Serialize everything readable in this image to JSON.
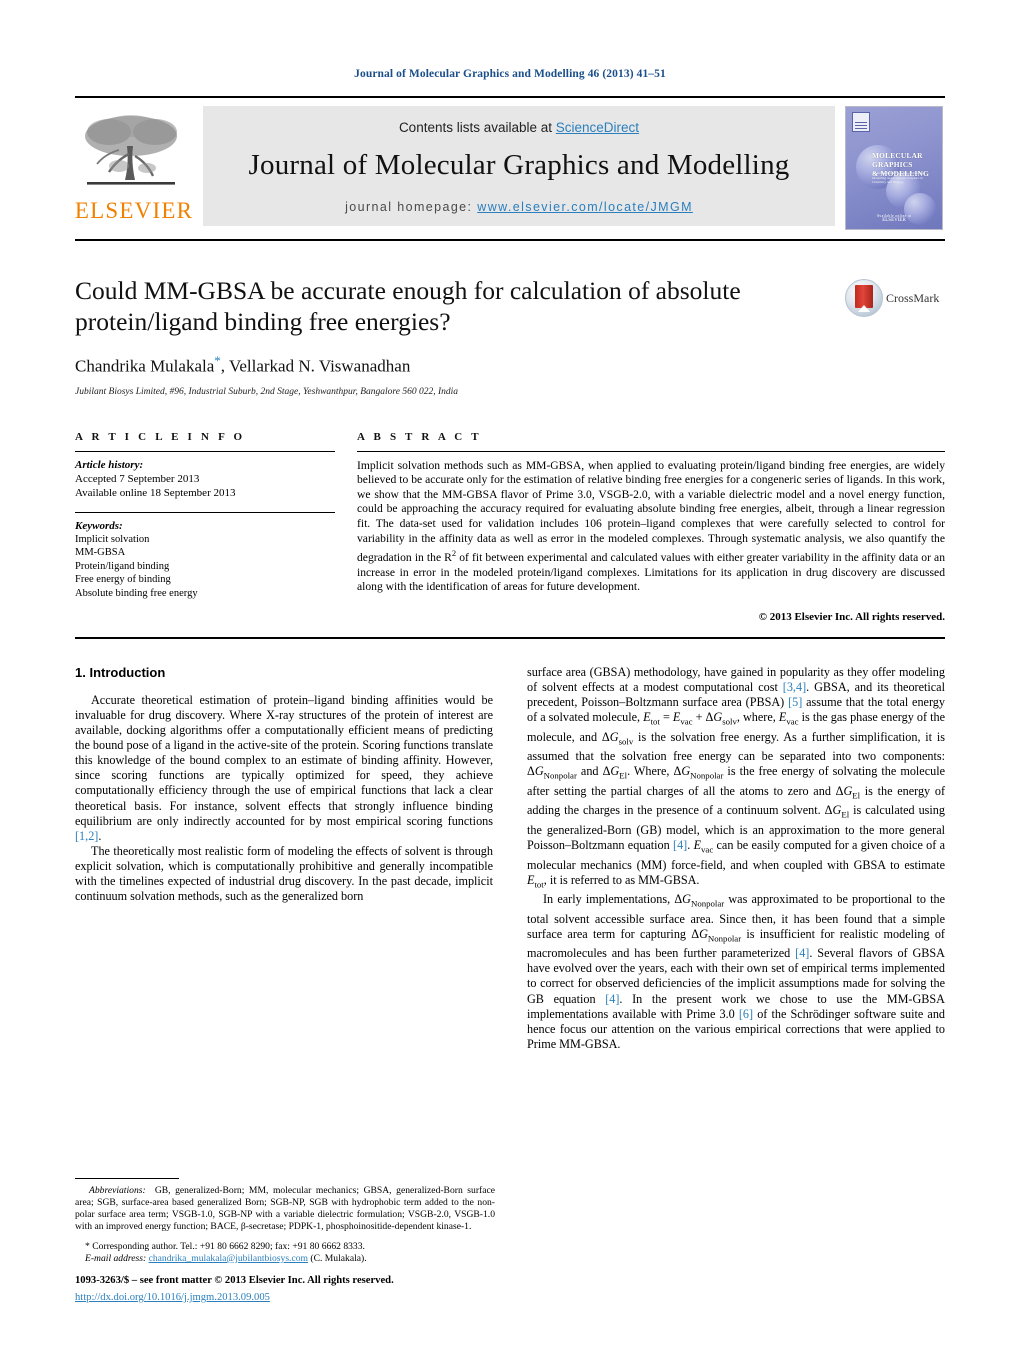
{
  "running_head": "Journal of Molecular Graphics and Modelling 46 (2013) 41–51",
  "masthead": {
    "publisher_name": "ELSEVIER",
    "contents_prefix": "Contents lists available at ",
    "contents_link": "ScienceDirect",
    "journal_title": "Journal of Molecular Graphics and Modelling",
    "homepage_prefix": "journal homepage: ",
    "homepage_url": "www.elsevier.com/locate/JMGM",
    "cover": {
      "title_line1": "MOLECULAR GRAPHICS",
      "title_line2": "& MODELLING",
      "kicker": "Journal of",
      "blurb": "An International Journal for Molecular Modelling and Computer Graphics in Chemistry and Biology",
      "publisher": "ELSEVIER",
      "availability": "Available online at"
    }
  },
  "article": {
    "title": "Could MM-GBSA be accurate enough for calculation of absolute protein/ligand binding free energies?",
    "authors": "Chandrika Mulakala, Vellarkad N. Viswanadhan",
    "author_star": "*",
    "affiliation": "Jubilant Biosys Limited, #96, Industrial Suburb, 2nd Stage, Yeshwanthpur, Bangalore 560 022, India",
    "crossmark_label": "CrossMark"
  },
  "article_info": {
    "heading": "A R T I C L E    I N F O",
    "history_label": "Article history:",
    "history": [
      "Accepted 7 September 2013",
      "Available online 18 September 2013"
    ],
    "keywords_label": "Keywords:",
    "keywords": [
      "Implicit solvation",
      "MM-GBSA",
      "Protein/ligand binding",
      "Free energy of binding",
      "Absolute binding free energy"
    ]
  },
  "abstract": {
    "heading": "A B S T R A C T",
    "text": "Implicit solvation methods such as MM-GBSA, when applied to evaluating protein/ligand binding free energies, are widely believed to be accurate only for the estimation of relative binding free energies for a congeneric series of ligands. In this work, we show that the MM-GBSA flavor of Prime 3.0, VSGB-2.0, with a variable dielectric model and a novel energy function, could be approaching the accuracy required for evaluating absolute binding free energies, albeit, through a linear regression fit. The data-set used for validation includes 106 protein–ligand complexes that were carefully selected to control for variability in the affinity data as well as error in the modeled complexes. Through systematic analysis, we also quantify the degradation in the R",
    "text_sup": "2",
    "text_tail": " of fit between experimental and calculated values with either greater variability in the affinity data or an increase in error in the modeled protein/ligand complexes. Limitations for its application in drug discovery are discussed along with the identification of areas for future development.",
    "copyright": "© 2013 Elsevier Inc. All rights reserved."
  },
  "introduction": {
    "section_number": "1.",
    "section_title": "Introduction",
    "left_paragraphs": [
      "Accurate theoretical estimation of protein–ligand binding affinities would be invaluable for drug discovery. Where X-ray structures of the protein of interest are available, docking algorithms offer a computationally efficient means of predicting the bound pose of a ligand in the active-site of the protein. Scoring functions translate this knowledge of the bound complex to an estimate of binding affinity. However, since scoring functions are typically optimized for speed, they achieve computationally efficiency through the use of empirical functions that lack a clear theoretical basis. For instance, solvent effects that strongly influence binding equilibrium are only indirectly accounted for by most empirical scoring functions [1,2].",
      "The theoretically most realistic form of modeling the effects of solvent is through explicit solvation, which is computationally prohibitive and generally incompatible with the timelines expected of industrial drug discovery. In the past decade, implicit continuum solvation methods, such as the generalized born"
    ],
    "right_paragraph_1": "surface area (GBSA) methodology, have gained in popularity as they offer modeling of solvent effects at a modest computational cost [3,4]. GBSA, and its theoretical precedent, Poisson–Boltzmann surface area (PBSA) [5] assume that the total energy of a solvated molecule, Etot = Evac + ΔGsolv, where, Evac is the gas phase energy of the molecule, and ΔGsolv is the solvation free energy. As a further simplification, it is assumed that the solvation free energy can be separated into two components: ΔGNonpolar and ΔGEl. Where, ΔGNonpolar is the free energy of solvating the molecule after setting the partial charges of all the atoms to zero and ΔGEl is the energy of adding the charges in the presence of a continuum solvent. ΔGEl is calculated using the generalized-Born (GB) model, which is an approximation to the more general Poisson–Boltzmann equation [4]. Evac can be easily computed for a given choice of a molecular mechanics (MM) force-field, and when coupled with GBSA to estimate Etot, it is referred to as MM-GBSA.",
    "right_paragraph_2": "In early implementations, ΔGNonpolar was approximated to be proportional to the total solvent accessible surface area. Since then, it has been found that a simple surface area term for capturing ΔGNonpolar is insufficient for realistic modeling of macromolecules and has been further parameterized [4]. Several flavors of GBSA have evolved over the years, each with their own set of empirical terms implemented to correct for observed deficiencies of the implicit assumptions made for solving the GB equation [4]. In the present work we chose to use the MM-GBSA implementations available with Prime 3.0 [6] of the Schrödinger software suite and hence focus our attention on the various empirical corrections that were applied to Prime MM-GBSA."
  },
  "footnotes": {
    "abbreviations_label": "Abbreviations:",
    "abbreviations_text": "GB, generalized-Born; MM, molecular mechanics; GBSA, generalized-Born surface area; SGB, surface-area based generalized Born; SGB-NP, SGB with hydrophobic term added to the non-polar surface area term; VSGB-1.0, SGB-NP with a variable dielectric formulation; VSGB-2.0, VSGB-1.0 with an improved energy function; BACE, β-secretase; PDPK-1, phosphoinositide-dependent kinase-1.",
    "corresponding_marker": "*",
    "corresponding_text": "Corresponding author. Tel.: +91 80 6662 8290; fax: +91 80 6662 8333.",
    "email_label": "E-mail address:",
    "email": "chandrika_mulakala@jubilantbiosys.com",
    "email_suffix": "(C. Mulakala)."
  },
  "footer": {
    "issn_line": "1093-3263/$ – see front matter © 2013 Elsevier Inc. All rights reserved.",
    "doi": "http://dx.doi.org/10.1016/j.jmgm.2013.09.005"
  },
  "colors": {
    "link": "#2b7fbd",
    "running_head": "#1a4f8a",
    "elsevier_orange": "#F08000",
    "band_gray": "#e7e7e7"
  }
}
